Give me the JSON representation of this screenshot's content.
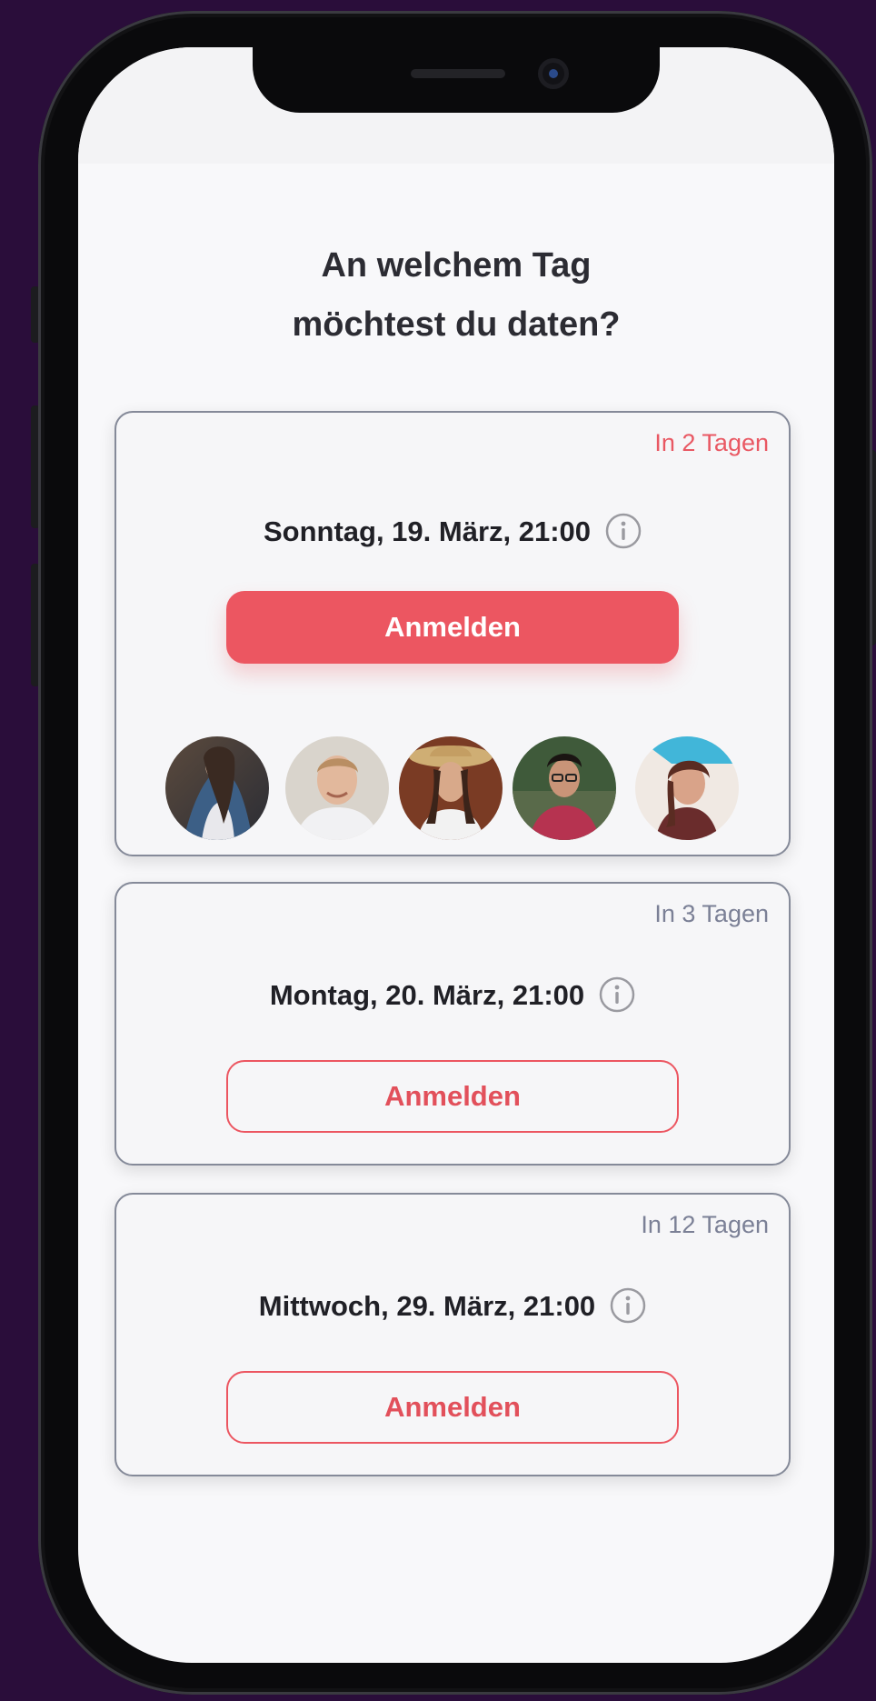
{
  "screen": {
    "title_line1": "An welchem Tag",
    "title_line2": "möchtest du daten?"
  },
  "dates": [
    {
      "badge": "In 2 Tagen",
      "date": "Sonntag, 19. März, 21:00",
      "button": "Anmelden",
      "selected": true
    },
    {
      "badge": "In 3 Tagen",
      "date": "Montag, 20. März, 21:00",
      "button": "Anmelden",
      "selected": false
    },
    {
      "badge": "In 12 Tagen",
      "date": "Mittwoch, 29. März, 21:00",
      "button": "Anmelden",
      "selected": false
    }
  ],
  "icons": {
    "info": "info-circle-icon",
    "avatar": "avatar-photo"
  },
  "colors": {
    "accent": "#ec5661",
    "muted_badge": "#7b8096",
    "card_border": "#858a99",
    "background": "#2a0d3a"
  }
}
